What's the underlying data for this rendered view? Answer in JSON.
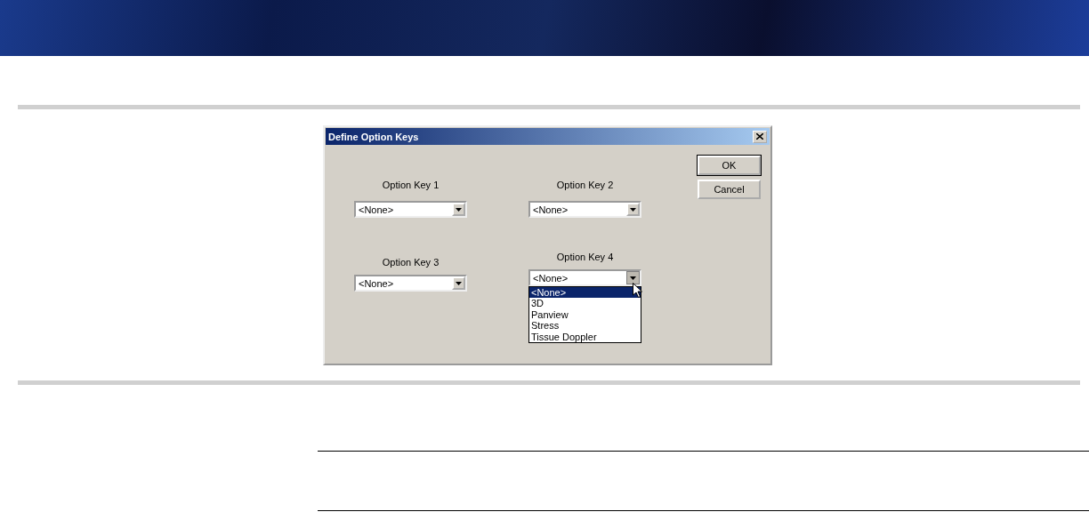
{
  "dialog": {
    "title": "Define Option Keys",
    "option_keys": [
      {
        "label": "Option Key 1",
        "value": "<None>",
        "expanded": false
      },
      {
        "label": "Option Key 2",
        "value": "<None>",
        "expanded": false
      },
      {
        "label": "Option Key 3",
        "value": "<None>",
        "expanded": false
      },
      {
        "label": "Option Key 4",
        "value": "<None>",
        "expanded": true,
        "options": [
          {
            "label": "<None>",
            "selected": true
          },
          {
            "label": "3D",
            "selected": false
          },
          {
            "label": "Panview",
            "selected": false
          },
          {
            "label": "Stress",
            "selected": false
          },
          {
            "label": "Tissue Doppler",
            "selected": false
          }
        ]
      }
    ],
    "buttons": [
      {
        "label": "OK",
        "default": true
      },
      {
        "label": "Cancel",
        "default": false
      }
    ]
  }
}
